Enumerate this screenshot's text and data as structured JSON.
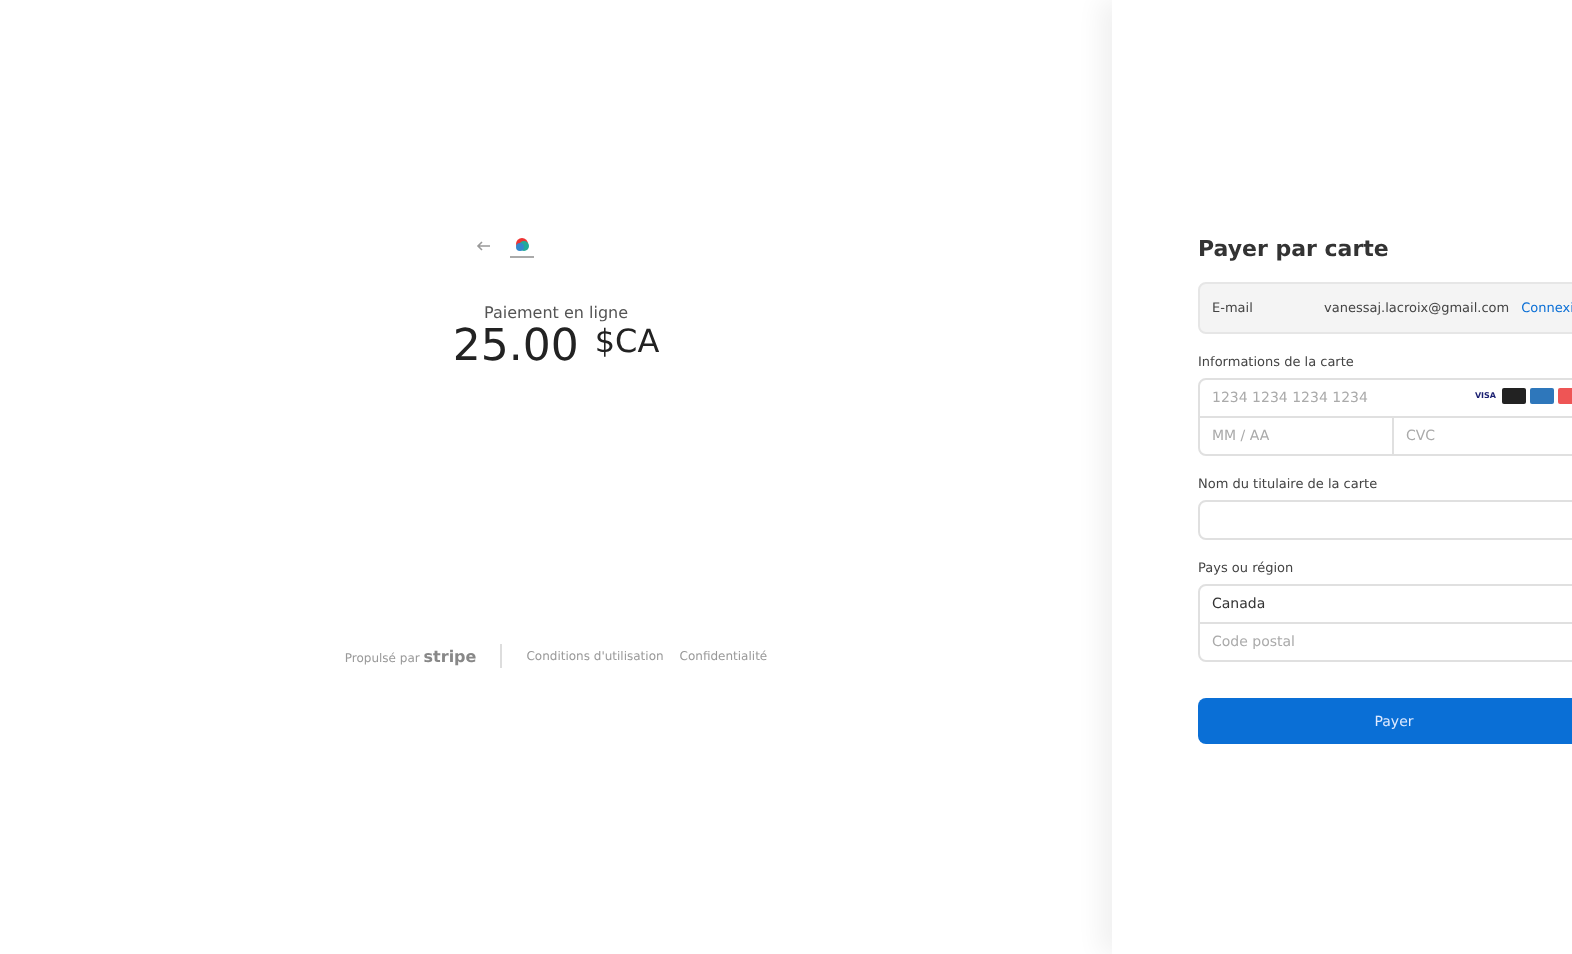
{
  "summary": {
    "title": "Paiement en ligne",
    "amount": "25.00",
    "currency": "$CA"
  },
  "footer": {
    "powered_by": "Propulsé par",
    "brand": "stripe",
    "links": [
      "Conditions d'utilisation",
      "Confidentialité"
    ]
  },
  "form": {
    "title": "Payer par carte",
    "email": {
      "label": "E-mail",
      "value": "vanessaj.lacroix@gmail.com",
      "link": "Connexi"
    },
    "card": {
      "label": "Informations de la carte",
      "number_placeholder": "1234 1234 1234 1234",
      "expiry_placeholder": "MM / AA",
      "cvc_placeholder": "CVC",
      "brands": [
        "VISA"
      ]
    },
    "name": {
      "label": "Nom du titulaire de la carte"
    },
    "country": {
      "label": "Pays ou région",
      "value": "Canada",
      "postal_placeholder": "Code postal"
    },
    "submit": "Payer"
  }
}
